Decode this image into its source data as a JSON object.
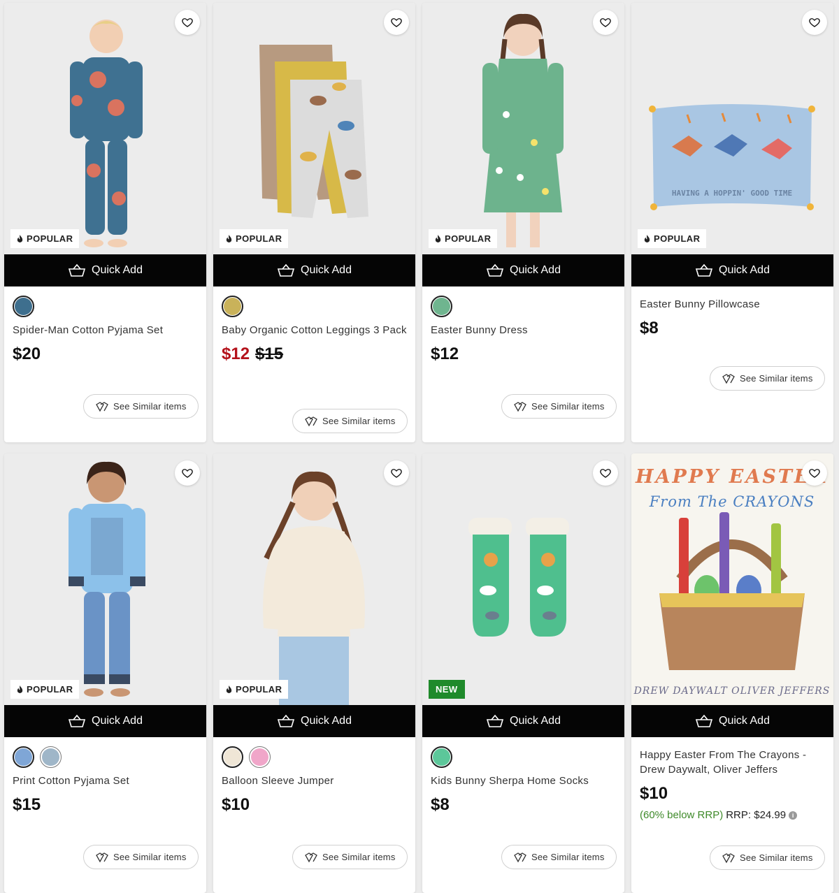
{
  "quick_add_label": "Quick Add",
  "see_similar_label": "See Similar items",
  "products": [
    {
      "name": "Spider-Man Cotton Pyjama Set",
      "price": "$20",
      "badge": "POPULAR",
      "swatches": [
        "#3e6f8e"
      ],
      "image": "spiderman-pyjamas-boy"
    },
    {
      "name": "Baby Organic Cotton Leggings 3 Pack",
      "price": "$12",
      "was_price": "$15",
      "badge": "POPULAR",
      "swatches": [
        "#c9b25a"
      ],
      "image": "leggings-three-pack"
    },
    {
      "name": "Easter Bunny Dress",
      "price": "$12",
      "badge": "POPULAR",
      "swatches": [
        "#6fb58f"
      ],
      "image": "easter-bunny-dress-girl"
    },
    {
      "name": "Easter Bunny Pillowcase",
      "price": "$8",
      "badge": "POPULAR",
      "swatches": [],
      "image": "bunny-pillowcase",
      "pillow_text": "HAVING A HOPPIN' GOOD TIME"
    },
    {
      "name": "Print Cotton Pyjama Set",
      "price": "$15",
      "badge": "POPULAR",
      "swatches": [
        "#7fa6d6",
        "#9fb6c8"
      ],
      "image": "print-pyjamas-boy"
    },
    {
      "name": "Balloon Sleeve Jumper",
      "price": "$10",
      "badge": "POPULAR",
      "swatches": [
        "#efe6d6",
        "#f0a6c9"
      ],
      "image": "balloon-sleeve-jumper-girl"
    },
    {
      "name": "Kids Bunny Sherpa Home Socks",
      "price": "$8",
      "badge": "NEW",
      "swatches": [
        "#5cc79a"
      ],
      "image": "bunny-sherpa-socks"
    },
    {
      "name": "Happy Easter From The Crayons - Drew Daywalt, Oliver Jeffers",
      "price": "$10",
      "rrp_pct": "(60% below RRP)",
      "rrp_text": "RRP: $24.99",
      "badge": "",
      "swatches": [],
      "image": "book-cover-crayons",
      "book_title_1": "HAPPY EASTER",
      "book_title_2": "From The CRAYONS",
      "book_authors": "DREW DAYWALT   OLIVER JEFFERS"
    }
  ],
  "colors": {
    "sale_red": "#b4121b",
    "rrp_green": "#3f8a2a",
    "new_badge": "#1f8a2b",
    "quick_add_bg": "#050505"
  },
  "icons": {
    "wishlist": "heart-icon",
    "popular": "flame-icon",
    "quick_add": "basket-icon",
    "similar": "similar-icon",
    "rrp_info": "info-icon"
  }
}
